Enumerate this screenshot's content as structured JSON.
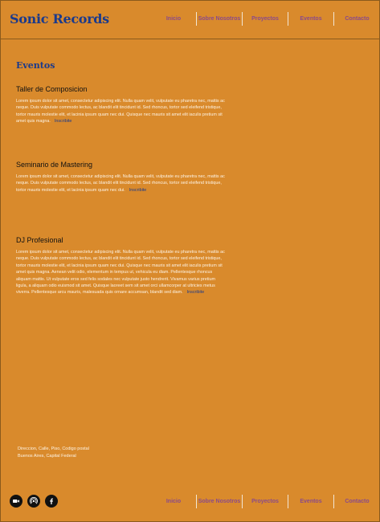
{
  "header": {
    "brand": "Sonic Records",
    "nav": [
      "Inicio",
      "Sobre Nosotros",
      "Proyectos",
      "Eventos",
      "Contacto"
    ]
  },
  "main": {
    "section_title": "Eventos",
    "events": [
      {
        "title": "Taller de Composicion",
        "text": "Lorem ipsum dolor sit amet, consectetur adipiscing elit. Nulla quam velit, vulputate eu pharetra nec, mattis ac neque. Duis vulputate commodo lectus, ac blandit elit tincidunt id. Sed rhoncus, tortor sed eleifend tristique, tortor mauris molestie elit, et lacinia ipsum quam nec dui. Quisque nec mauris sit amet elit iaculis pretium sit amet quis magna.",
        "link": "Inscribite"
      },
      {
        "title": "Seminario de Mastering",
        "text": "Lorem ipsum dolor sit amet, consectetur adipiscing elit. Nulla quam velit, vulputate eu pharetra nec, mattis ac neque. Duis vulputate commodo lectus, ac blandit elit tincidunt id. Sed rhoncus, tortor sed eleifend tristique, tortor mauris molestie elit, et lacinia ipsum quam nec dui.",
        "link": "Inscribite"
      },
      {
        "title": "DJ Profesional",
        "text": "Lorem ipsum dolor sit amet, consectetur adipiscing elit. Nulla quam velit, vulputate eu pharetra nec, mattis ac neque. Duis vulputate commodo lectus, ac blandit elit tincidunt id. Sed rhoncus, tortor sed eleifend tristique, tortor mauris molestie elit, et lacinia ipsum quam nec dui. Quisque nec mauris sit amet elit iaculis pretium sit amet quis magna. Aenean velit odio, elementum in tempus ut, vehicula eu diam. Pellentesque rhoncus aliquam mattis. Ut vulputate eros sed felis sodales nec vulputate justo hendrerit. Vivamus varius pretium ligula, a aliquam odio euismod sit amet. Quisque laoreet sem sit amet orci ullamcorper at ultricies metus viverra. Pellentesque arcu mauris, malesuada quis ornare accumsan, blandit sed diam.",
        "link": "Inscribite"
      }
    ]
  },
  "footer": {
    "address_line1": "Direccion, Calle, Piso, Codigo postal",
    "address_line2": "Buenos Aires, Capital Federal",
    "social_icons": [
      "video-camera-icon",
      "podcast-icon",
      "facebook-icon"
    ],
    "nav": [
      "Inicio",
      "Sobre Nosotros",
      "Proyectos",
      "Eventos",
      "Contacto"
    ]
  },
  "colors": {
    "background": "#d98a2c",
    "brand": "#1b3a8c",
    "nav_text": "#8a4a8a",
    "body_text": "#fdf3e4"
  }
}
